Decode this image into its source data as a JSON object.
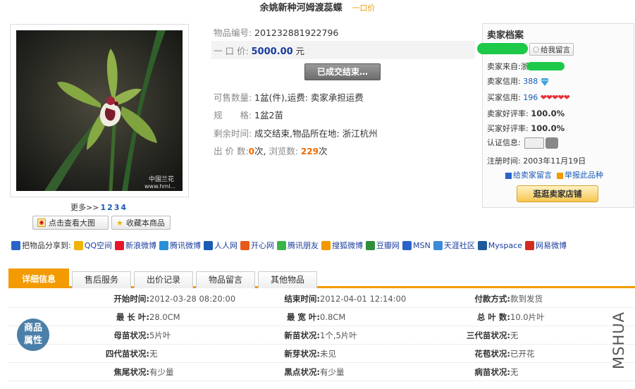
{
  "title": {
    "text": "余姚新种河姆渡蕊蝶",
    "tag": "一口价"
  },
  "gallery": {
    "watermark": [
      "中国兰花",
      "www.hml..."
    ],
    "more_label": "更多>>",
    "pages": [
      "1",
      "2",
      "3",
      "4"
    ],
    "view_large_label": "点击查看大图",
    "favorite_label": "收藏本商品"
  },
  "info": {
    "item_no_label": "物品编号:",
    "item_no": "201232881922796",
    "price_label": "一 口 价:",
    "price": "5000.00",
    "price_unit": "元",
    "ended_label": "已成交结束…",
    "qty_label": "可售数量:",
    "qty_value": "1盆(件),运费:",
    "shipping_value": "卖家承担运费",
    "spec_label": "规　　格:",
    "spec_value": "1盆2苗",
    "remain_label": "剩余时间:",
    "remain_value": "成交结束,物品所在地:",
    "location_value": "浙江杭州",
    "bids_label": "出 价 数:",
    "bids_value": "0",
    "bids_unit": "次,",
    "views_label": "浏览数:",
    "views_value": "229",
    "views_unit": "次"
  },
  "seller": {
    "heading": "卖家档案",
    "message_btn": "给我留言",
    "from_label": "卖家来自:",
    "from_value": "浙江",
    "seller_credit_label": "卖家信用:",
    "seller_credit_value": "388",
    "buyer_credit_label": "买家信用:",
    "buyer_credit_value": "196",
    "seller_rate_label": "卖家好评率:",
    "seller_rate_value": "100.0%",
    "buyer_rate_label": "买家好评率:",
    "buyer_rate_value": "100.0%",
    "cert_label": "认证信息:",
    "reg_label": "注册时间:",
    "reg_value": "2003年11月19日",
    "link_message": "给卖家留言",
    "link_report": "举报此品种",
    "shop_btn": "逛逛卖家店铺"
  },
  "share": {
    "label": "把物品分享到:",
    "items": [
      {
        "label": "QQ空间",
        "color": "#f0b400"
      },
      {
        "label": "新浪微博",
        "color": "#e6162d"
      },
      {
        "label": "腾讯微博",
        "color": "#2a8fd8"
      },
      {
        "label": "人人网",
        "color": "#1a5bb5"
      },
      {
        "label": "开心网",
        "color": "#e8591a"
      },
      {
        "label": "腾讯朋友",
        "color": "#3bb34a"
      },
      {
        "label": "搜狐微博",
        "color": "#f39800"
      },
      {
        "label": "豆瓣网",
        "color": "#2f8f3b"
      },
      {
        "label": "MSN",
        "color": "#2a64c9"
      },
      {
        "label": "天涯社区",
        "color": "#3c8ad8"
      },
      {
        "label": "Myspace",
        "color": "#1d5b9a"
      },
      {
        "label": "网易微博",
        "color": "#d52b1e"
      }
    ]
  },
  "tabs": [
    "详细信息",
    "售后服务",
    "出价记录",
    "物品留言",
    "其他物品"
  ],
  "attributes": {
    "badge": [
      "商品",
      "属性"
    ],
    "rows": [
      [
        {
          "k": "开始时间:",
          "v": "2012-03-28 08:20:00"
        },
        {
          "k": "结束时间:",
          "v": "2012-04-01 12:14:00"
        },
        {
          "k": "付款方式:",
          "v": "款到发货"
        }
      ],
      [
        {
          "k": "最 长 叶:",
          "v": "28.0CM"
        },
        {
          "k": "最 宽 叶:",
          "v": "0.8CM"
        },
        {
          "k": "总 叶 数:",
          "v": "10.0片叶"
        }
      ],
      [
        {
          "k": "母苗状况:",
          "v": "5片叶"
        },
        {
          "k": "新苗状况:",
          "v": "1个,5片叶"
        },
        {
          "k": "三代苗状况:",
          "v": "无"
        }
      ],
      [
        {
          "k": "四代苗状况:",
          "v": "无"
        },
        {
          "k": "新芽状况:",
          "v": "未见"
        },
        {
          "k": "花苞状况:",
          "v": "已开花"
        }
      ],
      [
        {
          "k": "焦尾状况:",
          "v": "有少量"
        },
        {
          "k": "黑点状况:",
          "v": "有少量"
        },
        {
          "k": "病苗状况:",
          "v": "无"
        }
      ]
    ]
  },
  "watermark_text": "MSHUA"
}
